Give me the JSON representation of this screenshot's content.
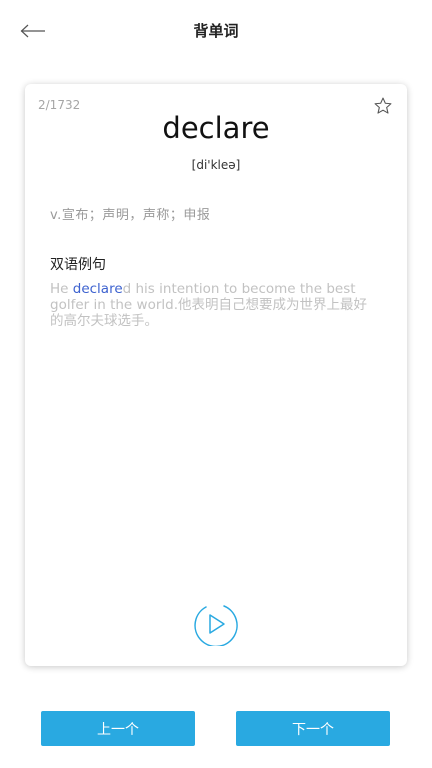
{
  "header": {
    "title": "背单词",
    "back_icon": "arrow-left-icon"
  },
  "card": {
    "counter": "2/1732",
    "star_icon": "star-outline-icon",
    "word": "declare",
    "phonetic": "[di'kleə]",
    "definition": "v.宣布；声明，声称；申报",
    "example_heading": "双语例句",
    "example": {
      "before": "He ",
      "highlight": "declare",
      "after": "d his intention to become the best golfer in the world.他表明自己想要成为世界上最好的高尔夫球选手。"
    },
    "play_icon": "play-circle-icon"
  },
  "buttons": {
    "prev_label": "上一个",
    "next_label": "下一个"
  },
  "colors": {
    "accent": "#29a9e1",
    "highlight": "#3d62cf",
    "muted_text": "#c2c2c2"
  }
}
